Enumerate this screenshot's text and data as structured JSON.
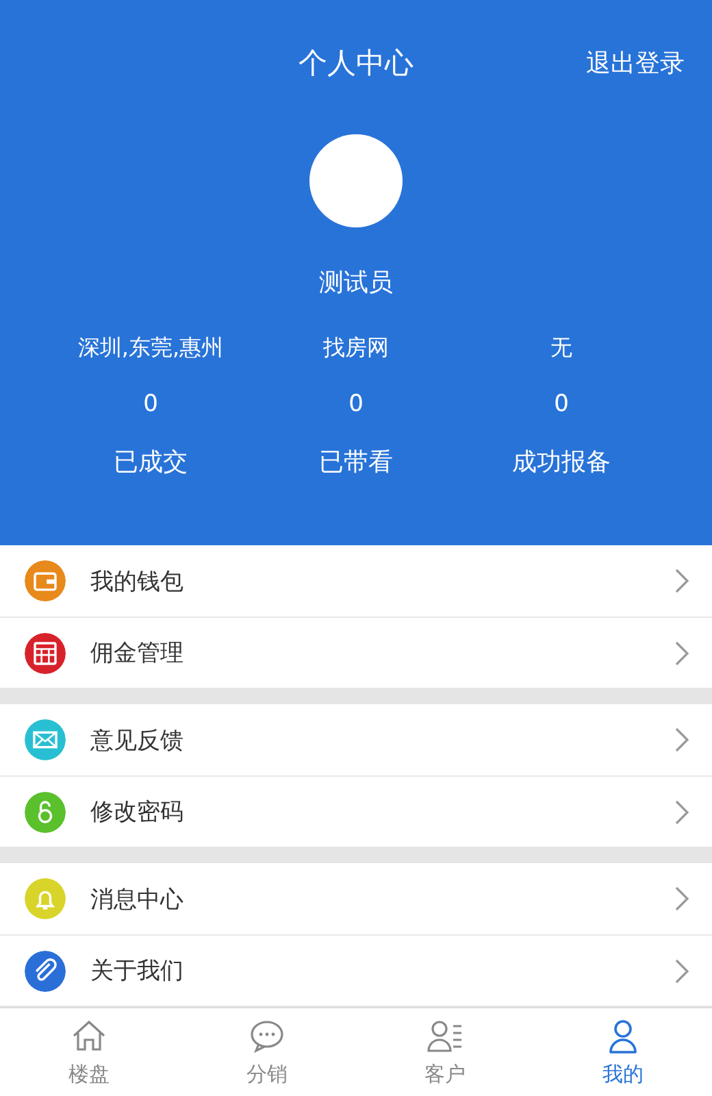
{
  "header": {
    "title": "个人中心",
    "logout": "退出登录",
    "user_name": "测试员"
  },
  "stats": [
    {
      "label": "深圳,东莞,惠州",
      "value": "0",
      "caption": "已成交"
    },
    {
      "label": "找房网",
      "value": "0",
      "caption": "已带看"
    },
    {
      "label": "无",
      "value": "0",
      "caption": "成功报备"
    }
  ],
  "menu_groups": [
    [
      {
        "label": "我的钱包",
        "color": "#e8891c"
      },
      {
        "label": "佣金管理",
        "color": "#d8222a"
      }
    ],
    [
      {
        "label": "意见反馈",
        "color": "#29bfd2"
      },
      {
        "label": "修改密码",
        "color": "#5ac02c"
      }
    ],
    [
      {
        "label": "消息中心",
        "color": "#d9d42a"
      },
      {
        "label": "关于我们",
        "color": "#2a6fd8"
      }
    ]
  ],
  "tabs": [
    {
      "label": "楼盘",
      "selected": false
    },
    {
      "label": "分销",
      "selected": false
    },
    {
      "label": "客户",
      "selected": false
    },
    {
      "label": "我的",
      "selected": true
    }
  ]
}
